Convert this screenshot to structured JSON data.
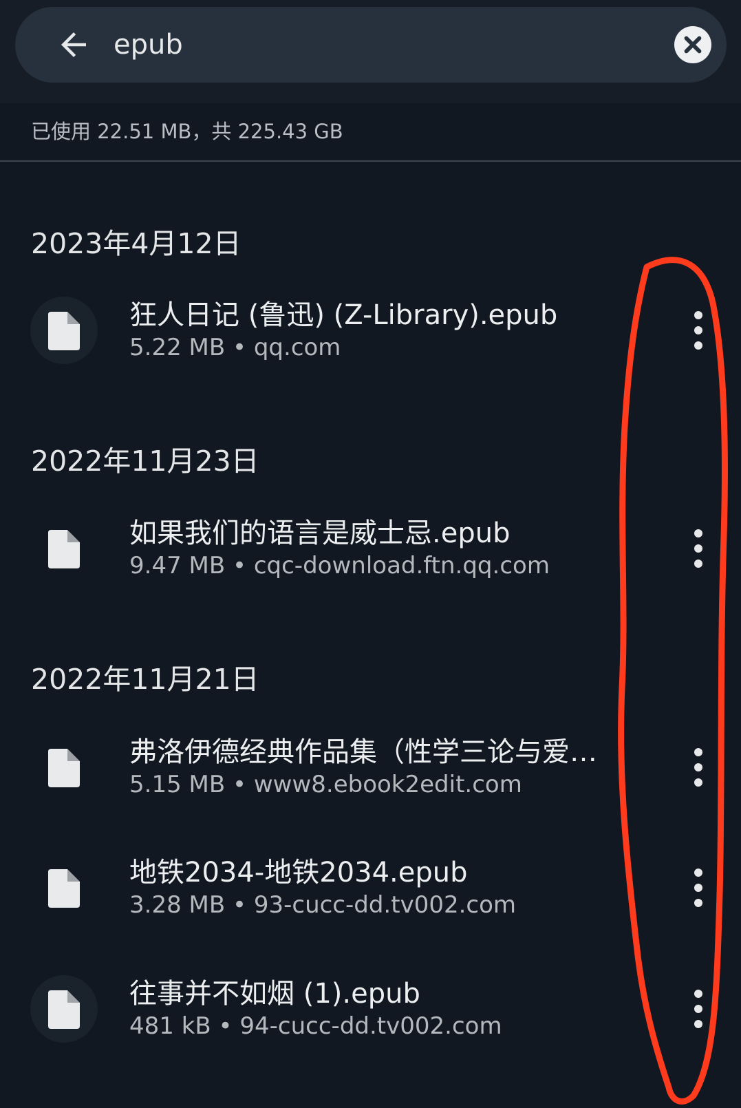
{
  "search": {
    "query": "epub"
  },
  "storage": {
    "text": "已使用 22.51 MB，共 225.43 GB"
  },
  "groups": [
    {
      "date": "2023年4月12日",
      "files": [
        {
          "name": "狂人日记 (鲁迅) (Z-Library).epub",
          "meta": "5.22 MB • qq.com"
        }
      ]
    },
    {
      "date": "2022年11月23日",
      "files": [
        {
          "name": "如果我们的语言是威士忌.epub",
          "meta": "9.47 MB • cqc-download.ftn.qq.com"
        }
      ]
    },
    {
      "date": "2022年11月21日",
      "files": [
        {
          "name": "弗洛伊德经典作品集（性学三论与爱…",
          "meta": "5.15 MB • www8.ebook2edit.com"
        },
        {
          "name": "地铁2034-地铁2034.epub",
          "meta": "3.28 MB • 93-cucc-dd.tv002.com"
        },
        {
          "name": "往事并不如烟 (1).epub",
          "meta": "481 kB • 94-cucc-dd.tv002.com"
        }
      ]
    }
  ],
  "icons": {
    "back": "arrow-left-icon",
    "clear": "close-circle-icon",
    "file": "document-icon",
    "more": "more-vert-icon"
  },
  "colors": {
    "background": "#111821",
    "search_bar": "#26313d",
    "annotation": "#ff3b1e"
  }
}
